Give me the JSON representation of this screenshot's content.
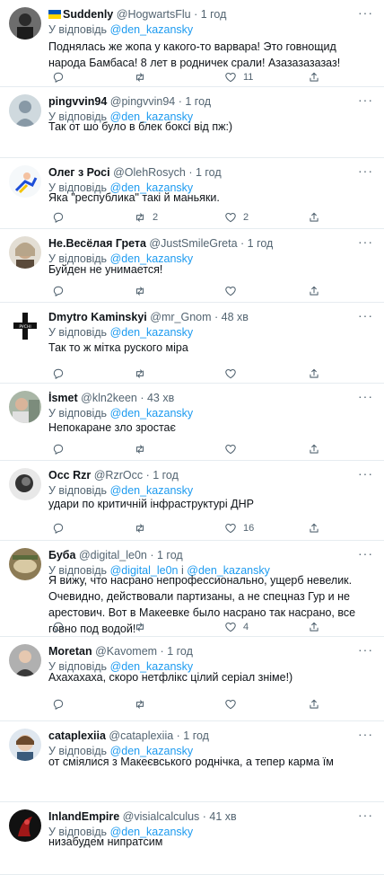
{
  "reply_prefix": "У відповідь",
  "colors": {
    "link": "#1d9bf0",
    "secondary": "#536471",
    "divider": "#e6ecf0"
  },
  "tweets": [
    {
      "name": "Suddenly",
      "handle": "@HogwartsFlu",
      "time": "1 год",
      "reply_to": [
        "@den_kazansky"
      ],
      "text": "Поднялась же жопа у какого-то варвара! Это говнощид народа Бамбаса! 8 лет в родничек срали! Азазазазазаз!",
      "replies": "",
      "retweets": "",
      "likes": "11"
    },
    {
      "name": "pingvvin94",
      "handle": "@pingvvin94",
      "time": "1 год",
      "reply_to": [
        "@den_kazansky"
      ],
      "text": "Так от шо було в блек боксі від пж:)",
      "replies": "",
      "retweets": "",
      "likes": ""
    },
    {
      "name": "Олег з Росі",
      "handle": "@OlehRosych",
      "time": "1 год",
      "reply_to": [
        "@den_kazansky"
      ],
      "text": "Яка \"республика\" такі й маньяки.",
      "replies": "",
      "retweets": "2",
      "likes": "2"
    },
    {
      "name": "Не.Весёлая Грета",
      "handle": "@JustSmileGreta",
      "time": "1 год",
      "reply_to": [
        "@den_kazansky"
      ],
      "text": "Буйден не унимается!",
      "replies": "",
      "retweets": "",
      "likes": ""
    },
    {
      "name": "Dmytro Kaminskyi",
      "handle": "@mr_Gnom",
      "time": "48 хв",
      "reply_to": [
        "@den_kazansky"
      ],
      "text": "Так то ж мітка руского міра",
      "replies": "",
      "retweets": "",
      "likes": ""
    },
    {
      "name": "İsmet",
      "handle": "@kln2keen",
      "time": "43 хв",
      "reply_to": [
        "@den_kazansky"
      ],
      "text": "Непокаране зло зростає",
      "replies": "",
      "retweets": "",
      "likes": ""
    },
    {
      "name": "Occ Rzr",
      "handle": "@RzrOcc",
      "time": "1 год",
      "reply_to": [
        "@den_kazansky"
      ],
      "text": "удари по критичній інфраструктурі ДНР",
      "replies": "",
      "retweets": "",
      "likes": "16"
    },
    {
      "name": "Буба",
      "handle": "@digital_le0n",
      "time": "1 год",
      "reply_to": [
        "@digital_le0n",
        "@den_kazansky"
      ],
      "reply_joiner": "і",
      "text": "Я вижу, что насрано непрофессионально, ущерб невелик. Очевидно, действовали партизаны, а не спецназ Гур и не арестович. Вот в Макеевке было насрано так насрано, все говно под водой!",
      "replies": "",
      "retweets": "",
      "likes": "4"
    },
    {
      "name": "Moretan",
      "handle": "@Kavomem",
      "time": "1 год",
      "reply_to": [
        "@den_kazansky"
      ],
      "text": "Ахахахаха, скоро нетфлікс цілий серіал зніме!)",
      "replies": "",
      "retweets": "",
      "likes": ""
    },
    {
      "name": "cataplexiia",
      "handle": "@cataplexiia",
      "time": "1 год",
      "reply_to": [
        "@den_kazansky"
      ],
      "text": "от сміялися з Макеєвського роднічка, а тепер карма їм",
      "replies": "",
      "retweets": "",
      "likes": ""
    },
    {
      "name": "InlandEmpire",
      "handle": "@visialcalculus",
      "time": "41 хв",
      "reply_to": [
        "@den_kazansky"
      ],
      "text": "низабудем нипратсим",
      "replies": "",
      "retweets": "",
      "likes": ""
    }
  ]
}
